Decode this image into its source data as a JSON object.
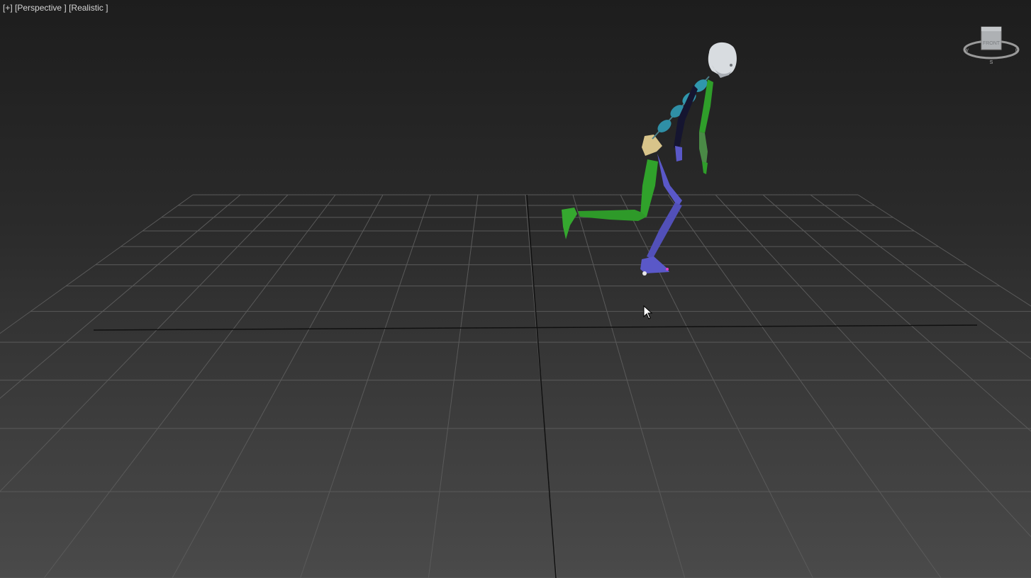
{
  "viewport": {
    "plus_menu": "[+]",
    "view_mode": "[Perspective ]",
    "shading_mode": "[Realistic ]"
  },
  "viewcube": {
    "face_label": "FRONT",
    "compass_south": "S",
    "compass_west": "W",
    "compass_east": "E"
  },
  "colors": {
    "grid": "#5a5a5a",
    "axis": "#101010",
    "left_limbs": "#2f9e2a",
    "right_limbs": "#5a58c8",
    "spine": "#2f8fa6",
    "head": "#d8dce0",
    "pelvis": "#d8c48a"
  },
  "icons": {
    "cursor": "arrow-cursor-icon",
    "viewcube": "viewcube-icon"
  }
}
